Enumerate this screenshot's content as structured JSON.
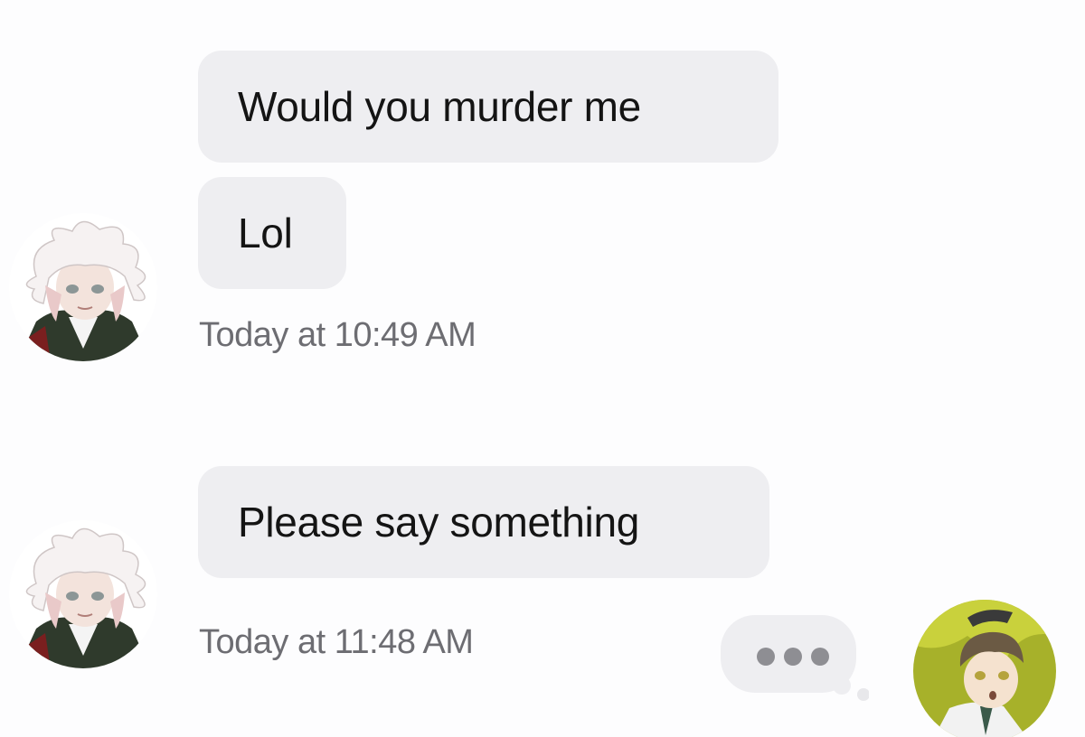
{
  "conversation": {
    "messages": [
      {
        "text": "Would you murder me"
      },
      {
        "text": "Lol"
      },
      {
        "text": "Please say something"
      }
    ],
    "timestamps": [
      "Today at 10:49 AM",
      "Today at 11:48 AM"
    ]
  },
  "colors": {
    "background": "#fdfdfe",
    "bubble": "#eeeef1",
    "timestamp": "#6d6d72",
    "typing_dots": "#8e8e93"
  },
  "icons": {
    "typing_indicator": "typing-dots-icon"
  }
}
